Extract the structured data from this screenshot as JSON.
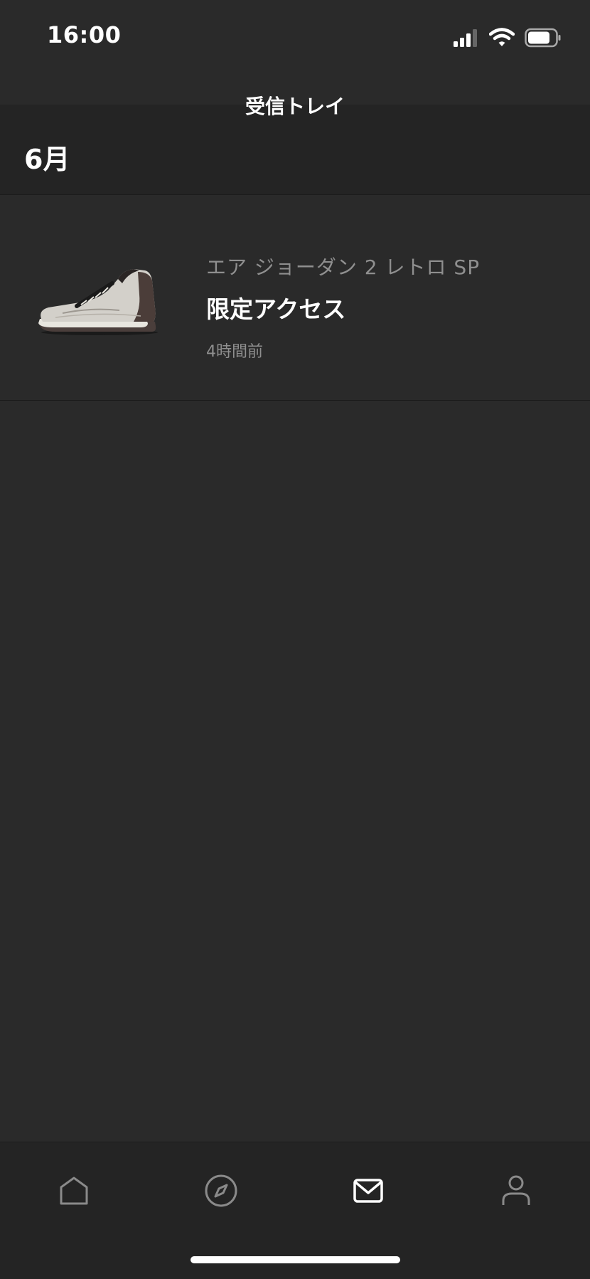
{
  "status_bar": {
    "time": "16:00",
    "icons": [
      "signal-icon",
      "wifi-icon",
      "battery-icon"
    ]
  },
  "nav": {
    "title": "受信トレイ"
  },
  "section": {
    "title": "6月"
  },
  "notifications": [
    {
      "product": "エア ジョーダン 2 レトロ SP",
      "title": "限定アクセス",
      "time": "4時間前",
      "thumbnail": "sneaker-image"
    }
  ],
  "tab_bar": {
    "items": [
      {
        "icon": "home-icon",
        "active": false
      },
      {
        "icon": "compass-icon",
        "active": false
      },
      {
        "icon": "inbox-icon",
        "active": true
      },
      {
        "icon": "profile-icon",
        "active": false
      }
    ]
  },
  "colors": {
    "background": "#2a2a2a",
    "header_background": "#242424",
    "text_primary": "#ffffff",
    "text_secondary": "#8f8f8f",
    "tab_inactive": "#8a8a8a"
  }
}
